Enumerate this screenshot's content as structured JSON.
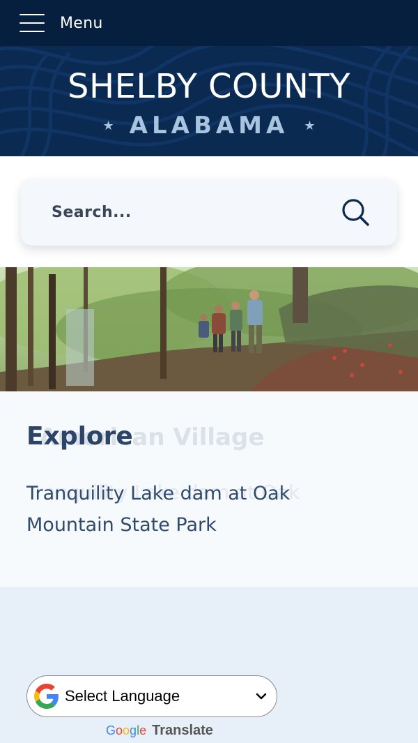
{
  "nav": {
    "menu_label": "Menu"
  },
  "header": {
    "title": "SHELBY COUNTY",
    "subtitle": "ALABAMA",
    "star": "★"
  },
  "search": {
    "placeholder": "Search..."
  },
  "hero": {
    "alt": "Hikers walking up a wooded trail"
  },
  "explore": {
    "heading": "Explore",
    "caption": "Tranquility Lake dam at Oak Mountain State Park",
    "ghost_heading": "American Village",
    "ghost_caption": "Tranquility Lake dam at Oak"
  },
  "translate": {
    "select_label": "Select Language",
    "google_letters": [
      "G",
      "o",
      "o",
      "g",
      "l",
      "e"
    ],
    "google_colors": [
      "#4285F4",
      "#EA4335",
      "#FBBC05",
      "#4285F4",
      "#34A853",
      "#EA4335"
    ],
    "translate_label": "Translate"
  },
  "colors": {
    "nav_bg": "#061f3e",
    "banner_bg": "#0b2a52",
    "accent_text": "#2b4468",
    "page_bg": "#e7f0f9"
  },
  "icons": [
    "hamburger-icon",
    "search-icon",
    "google-g-icon",
    "chevron-down-icon",
    "star-icon"
  ]
}
